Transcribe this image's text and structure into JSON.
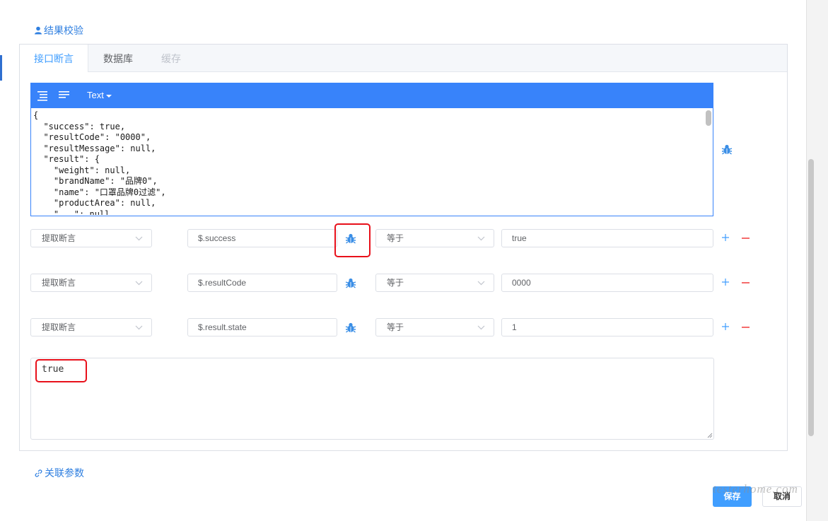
{
  "sections": {
    "result_check": "结果校验",
    "related_params": "关联参数"
  },
  "tabs": [
    {
      "label": "接口断言",
      "state": "active"
    },
    {
      "label": "数据库",
      "state": "normal"
    },
    {
      "label": "缓存",
      "state": "disabled"
    }
  ],
  "editor": {
    "mode": "Text",
    "content": "{\n  \"success\": true,\n  \"resultCode\": \"0000\",\n  \"resultMessage\": null,\n  \"result\": {\n    \"weight\": null,\n    \"brandName\": \"品牌0\",\n    \"name\": \"口罩品牌0过滤\",\n    \"productArea\": null,\n    \"   \": null,"
  },
  "assertions": [
    {
      "type": "提取断言",
      "path": "$.success",
      "operator": "等于",
      "expected": "true"
    },
    {
      "type": "提取断言",
      "path": "$.resultCode",
      "operator": "等于",
      "expected": "0000"
    },
    {
      "type": "提取断言",
      "path": "$.result.state",
      "operator": "等于",
      "expected": "1"
    }
  ],
  "result_output": "true",
  "buttons": {
    "save": "保存",
    "cancel": "取消"
  },
  "watermark": "testerhome.com",
  "colors": {
    "primary": "#409eff",
    "editor_toolbar": "#3883fa",
    "danger": "#f56c6c",
    "highlight": "#e8101a"
  }
}
